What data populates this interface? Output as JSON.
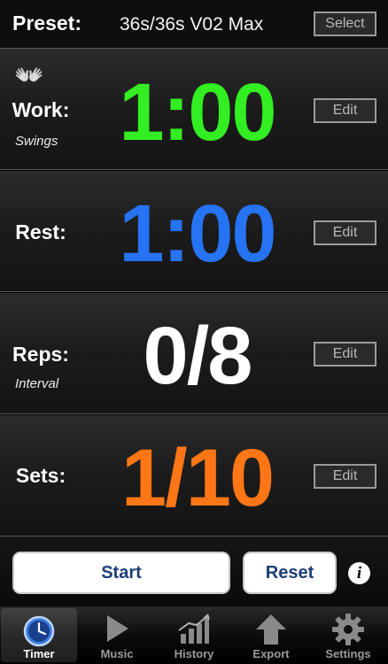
{
  "preset": {
    "label": "Preset:",
    "value": "36s/36s V02 Max",
    "select_label": "Select"
  },
  "rows": [
    {
      "label": "Work:",
      "sub": "Swings",
      "value": "1:00",
      "edit_label": "Edit",
      "color": "#33ee22"
    },
    {
      "label": "Rest:",
      "sub": "",
      "value": "1:00",
      "edit_label": "Edit",
      "color": "#2673f4"
    },
    {
      "label": "Reps:",
      "sub": "Interval",
      "value": "0/8",
      "edit_label": "Edit",
      "color": "#ffffff"
    },
    {
      "label": "Sets:",
      "sub": "",
      "value": "1/10",
      "edit_label": "Edit",
      "color": "#ff7616"
    }
  ],
  "controls": {
    "start_label": "Start",
    "reset_label": "Reset",
    "info_glyph": "i"
  },
  "tabs": [
    {
      "label": "Timer",
      "icon": "clock-icon",
      "active": true
    },
    {
      "label": "Music",
      "icon": "play-icon",
      "active": false
    },
    {
      "label": "History",
      "icon": "bar-chart-icon",
      "active": false
    },
    {
      "label": "Export",
      "icon": "upload-arrow-icon",
      "active": false
    },
    {
      "label": "Settings",
      "icon": "gear-icon",
      "active": false
    }
  ],
  "colors": {
    "button_text": "#1d3e76",
    "tab_active_icon": "#4a8cf0"
  }
}
